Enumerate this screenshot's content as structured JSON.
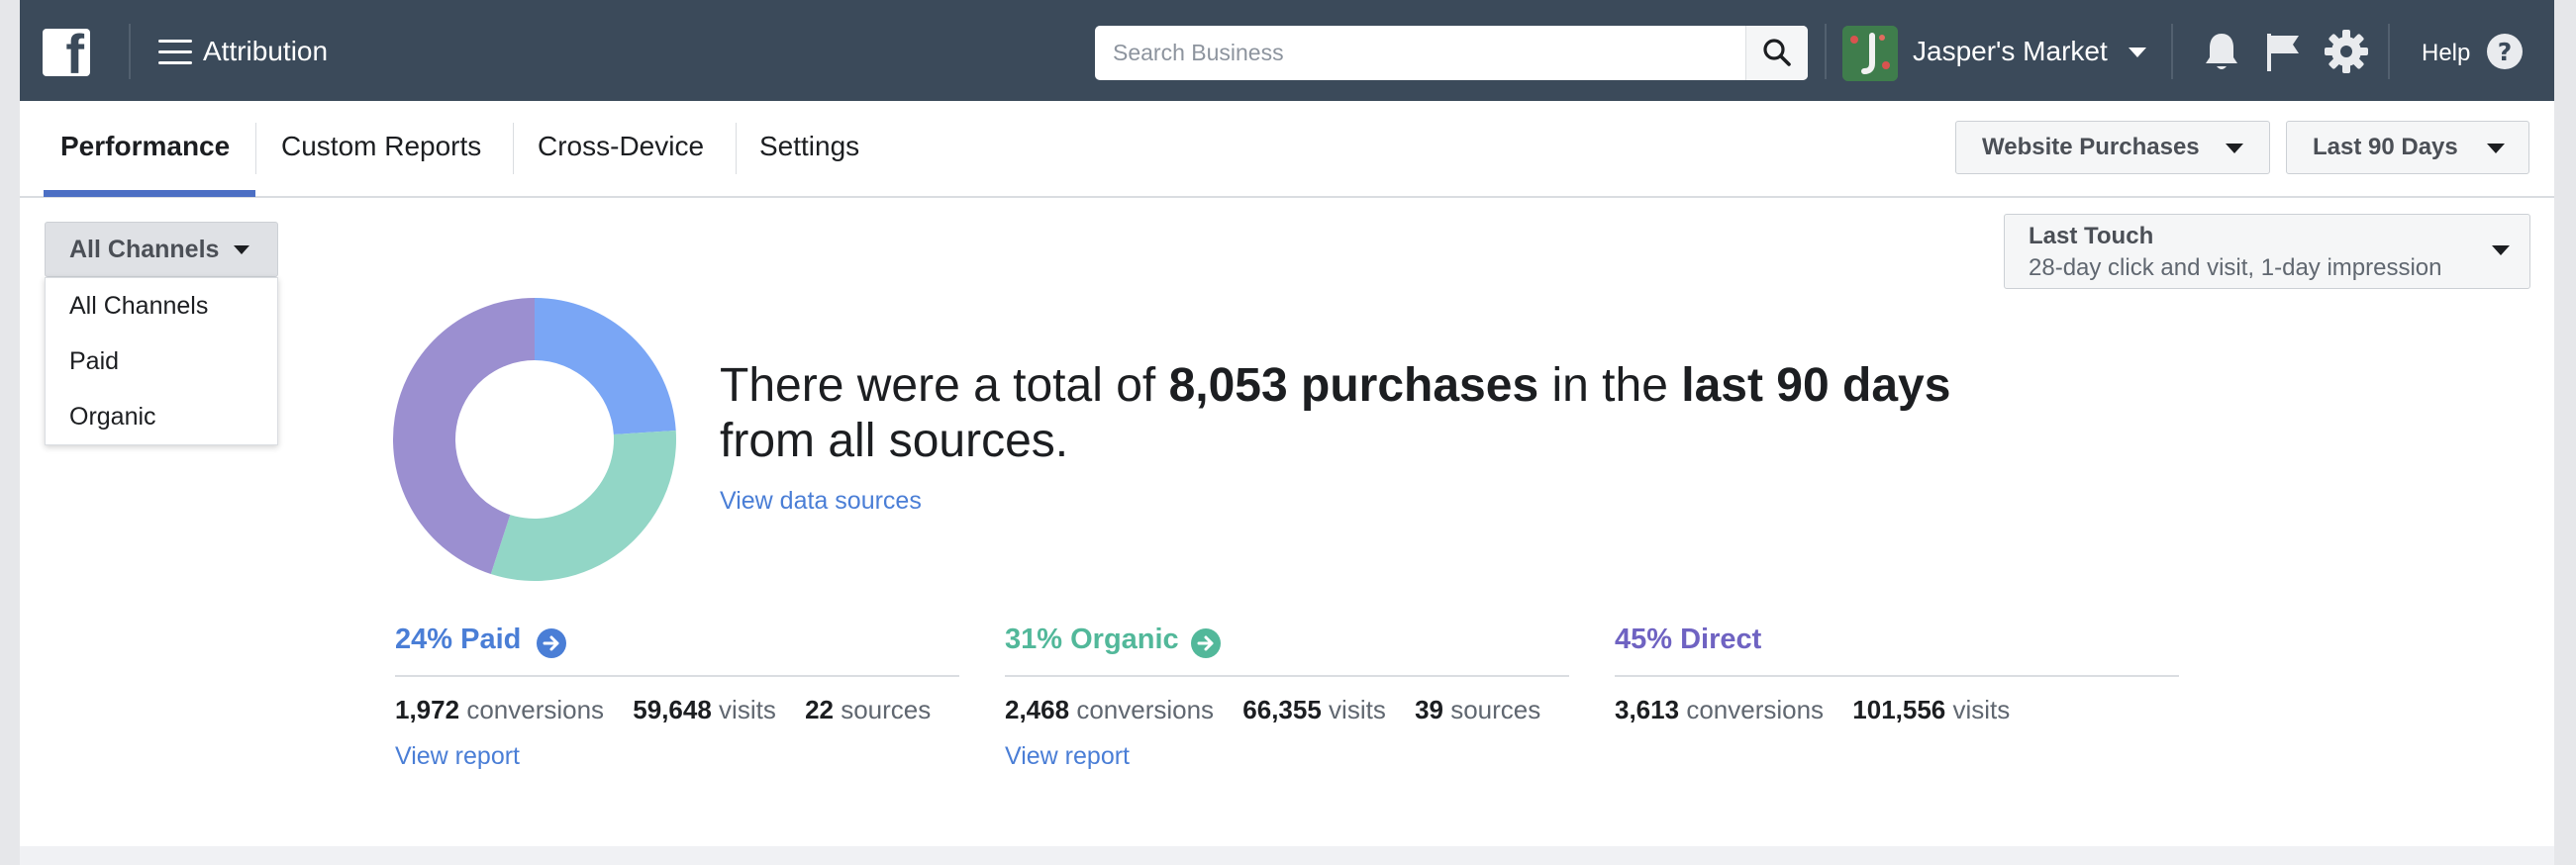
{
  "header": {
    "app_title": "Attribution",
    "search_placeholder": "Search Business",
    "account_name": "Jasper's Market",
    "help_label": "Help"
  },
  "nav": {
    "tabs": [
      {
        "label": "Performance",
        "active": true
      },
      {
        "label": "Custom Reports",
        "active": false
      },
      {
        "label": "Cross-Device",
        "active": false
      },
      {
        "label": "Settings",
        "active": false
      }
    ],
    "conversion_event": "Website Purchases",
    "date_range": "Last 90 Days"
  },
  "channel_filter": {
    "selected": "All Channels",
    "options": [
      "All Channels",
      "Paid",
      "Organic"
    ]
  },
  "attribution_model": {
    "title": "Last Touch",
    "description": "28-day click and visit, 1-day impression"
  },
  "summary": {
    "prefix": "There were a total of ",
    "purchases": "8,053 purchases",
    "middle": " in the ",
    "period": "last 90 days",
    "suffix": "from all sources.",
    "view_sources_link": "View data sources"
  },
  "chart_data": {
    "type": "pie",
    "categories": [
      "Paid",
      "Organic",
      "Direct"
    ],
    "values": [
      24,
      31,
      45
    ],
    "colors": [
      "#7aa6f5",
      "#92d6c6",
      "#9b8fd0"
    ]
  },
  "channels": [
    {
      "title": "24% Paid",
      "color": "#4a7ed6",
      "conversions": "1,972",
      "conversions_label": "conversions",
      "visits": "59,648",
      "visits_label": "visits",
      "sources": "22",
      "sources_label": "sources",
      "link": "View report"
    },
    {
      "title": "31% Organic",
      "color": "#52b89a",
      "conversions": "2,468",
      "conversions_label": "conversions",
      "visits": "66,355",
      "visits_label": "visits",
      "sources": "39",
      "sources_label": "sources",
      "link": "View report"
    },
    {
      "title": "45% Direct",
      "color": "#6f63c2",
      "conversions": "3,613",
      "conversions_label": "conversions",
      "visits": "101,556",
      "visits_label": "visits"
    }
  ],
  "icons": {
    "logo": "facebook-logo-icon",
    "menu": "hamburger-menu-icon",
    "search": "search-icon",
    "notifications": "bell-icon",
    "pages": "flag-icon",
    "settings": "gear-icon",
    "help": "question-circle-icon"
  }
}
